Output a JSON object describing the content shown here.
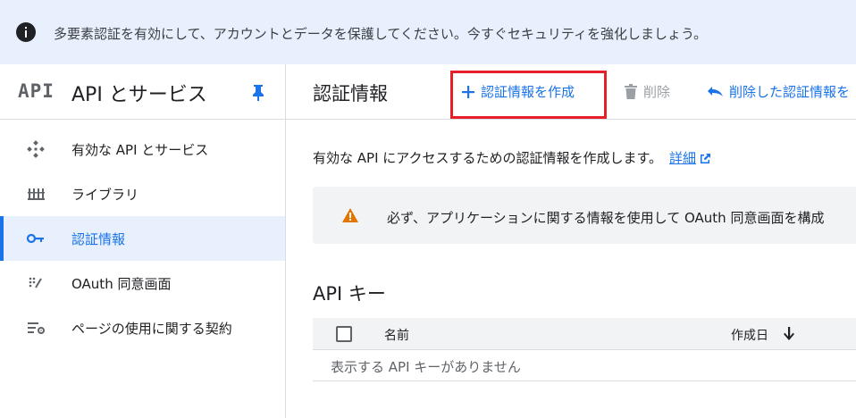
{
  "banner": {
    "text": "多要素認証を有効にして、アカウントとデータを保護してください。今すぐセキュリティを強化しましょう。"
  },
  "sidebar": {
    "logo_text": "API",
    "title": "API とサービス",
    "items": [
      {
        "label": "有効な API とサービス",
        "icon": "api-diamond-icon",
        "active": false
      },
      {
        "label": "ライブラリ",
        "icon": "library-icon",
        "active": false
      },
      {
        "label": "認証情報",
        "icon": "key-icon",
        "active": true
      },
      {
        "label": "OAuth 同意画面",
        "icon": "consent-screen-icon",
        "active": false
      },
      {
        "label": "ページの使用に関する契約",
        "icon": "settings-list-icon",
        "active": false
      }
    ]
  },
  "toolbar": {
    "title": "認証情報",
    "create_label": "認証情報を作成",
    "delete_label": "削除",
    "undelete_label": "削除した認証情報を"
  },
  "main": {
    "description": "有効な API にアクセスするための認証情報を作成します。",
    "detail_link": "詳細",
    "warning_text": "必ず、アプリケーションに関する情報を使用して OAuth 同意画面を構成",
    "api_keys_title": "API キー",
    "table": {
      "columns": [
        "名前",
        "作成日"
      ],
      "empty_text": "表示する API キーがありません"
    }
  },
  "colors": {
    "accent": "#1a73e8",
    "banner_bg": "#e8f0fe",
    "highlight": "#e5202a",
    "warning": "#e37400"
  }
}
